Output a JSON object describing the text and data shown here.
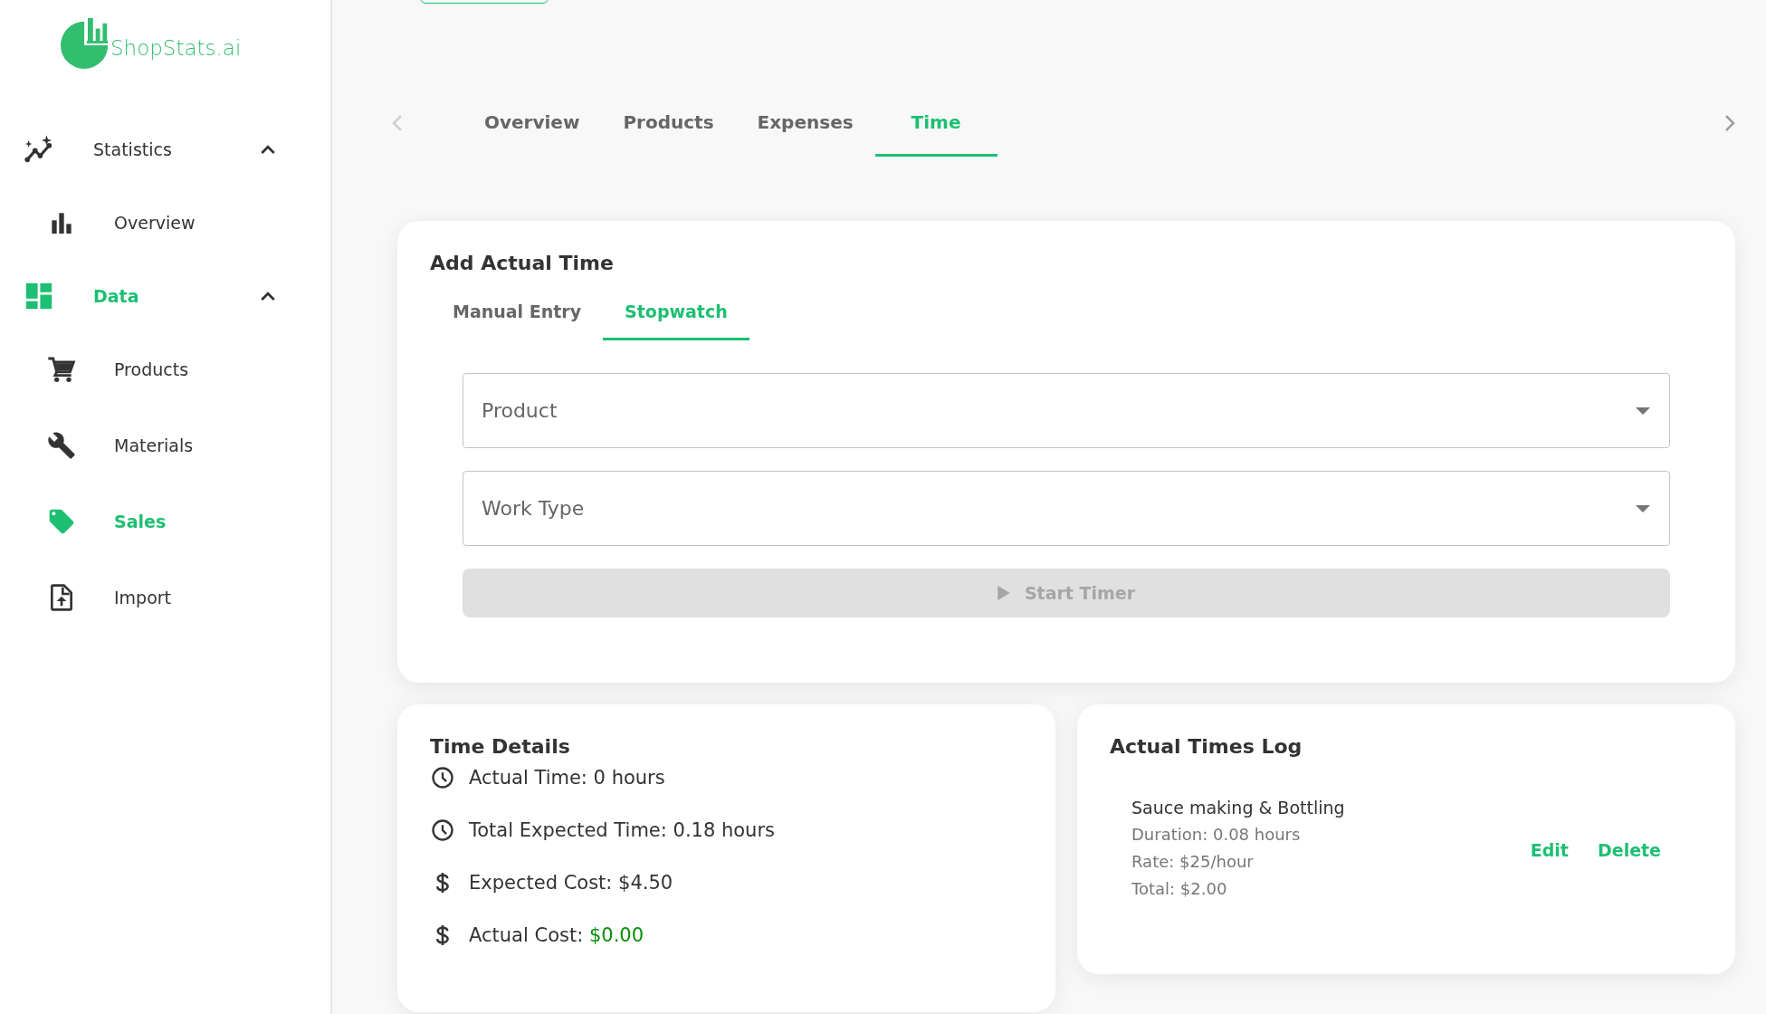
{
  "sidebar": {
    "logo": "ShopStats.ai",
    "groups": [
      {
        "label": "Statistics",
        "kind": "sparkline",
        "expanded": true,
        "selected": false,
        "children": [
          {
            "label": "Overview",
            "kind": "bars",
            "selected": false
          }
        ]
      },
      {
        "label": "Data",
        "kind": "dashboard",
        "expanded": true,
        "selected": true,
        "children": [
          {
            "label": "Products",
            "kind": "cart",
            "selected": false
          },
          {
            "label": "Materials",
            "kind": "wrench",
            "selected": false
          },
          {
            "label": "Sales",
            "kind": "tag",
            "selected": true
          },
          {
            "label": "Import",
            "kind": "upload",
            "selected": false
          }
        ]
      }
    ]
  },
  "tabs": [
    {
      "label": "Overview",
      "selected": false
    },
    {
      "label": "Products",
      "selected": false
    },
    {
      "label": "Expenses",
      "selected": false
    },
    {
      "label": "Time",
      "selected": true
    }
  ],
  "add_card": {
    "title": "Add Actual Time",
    "tabs": [
      {
        "label": "Manual Entry",
        "selected": false
      },
      {
        "label": "Stopwatch",
        "selected": true
      }
    ],
    "fields": [
      {
        "placeholder": "Product"
      },
      {
        "placeholder": "Work Type"
      }
    ],
    "start_button": {
      "label": "Start Timer",
      "disabled": true
    }
  },
  "details": {
    "title": "Time Details",
    "rows": [
      {
        "kind": "time",
        "label": "Actual Time:",
        "value": "0 hours",
        "highlight": false
      },
      {
        "kind": "time",
        "label": "Total Expected Time:",
        "value": "0.18 hours",
        "highlight": false
      },
      {
        "kind": "money",
        "label": "Expected Cost:",
        "value": "$4.50",
        "highlight": false
      },
      {
        "kind": "money",
        "label": "Actual Cost:",
        "value": "$0.00",
        "highlight": true
      }
    ]
  },
  "log": {
    "title": "Actual Times Log",
    "entries": [
      {
        "name": "Sauce making & Bottling",
        "lines": [
          "Duration: 0.08 hours",
          "Rate: $25/hour",
          "Total: $2.00"
        ],
        "actions": [
          "Edit",
          "Delete"
        ]
      }
    ]
  }
}
